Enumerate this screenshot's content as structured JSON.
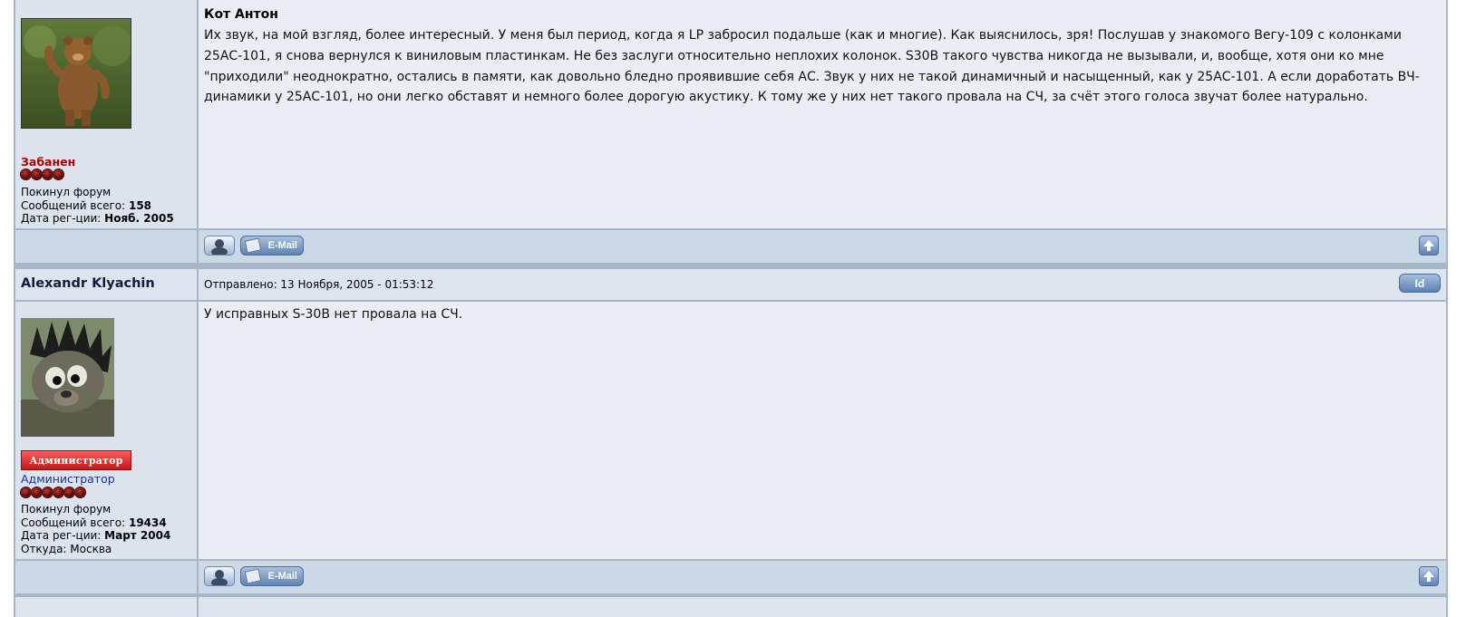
{
  "post1": {
    "quote_author": "Кот Антон",
    "body": "Их звук, на мой взгляд, более интересный. У меня был период, когда я LP забросил подальше (как и многие). Как выяснилось, зря! Послушав у знакомого Вегу-109 с колонками 25АС-101, я снова вернулся к виниловым пластинкам. Не без заслуги относительно неплохих колонок. S30B такого чувства никогда не вызывали, и, вообще, хотя они ко мне \"приходили\" неоднократно, остались в памяти, как довольно бледно проявившие себя АС. Звук у них не такой динамичный и насыщенный, как у 25АС-101. А если доработать ВЧ-динамики у 25АС-101, но они легко обставят и немного более дорогую акустику. К тому же у них нет такого провала на СЧ, за счёт этого голоса звучат более натурально.",
    "user": {
      "status": "Забанен",
      "status_color": "#b30000",
      "rank_stars": 4,
      "online": "Покинул форум",
      "posts_label": "Сообщений всего:",
      "posts_value": "158",
      "reg_label": "Дата рег-ции:",
      "reg_value": "Нояб. 2005",
      "avatar": "bear-avatar"
    }
  },
  "post2": {
    "author": "Alexandr Klyachin",
    "posted": "Отправлено: 13 Ноября, 2005 - 01:53:12",
    "id_label": "Id",
    "body": "У исправных S-30B нет провала на СЧ.",
    "user": {
      "badge": "Администратор",
      "role": "Администратор",
      "role_color": "#1a2fa0",
      "rank_stars": 6,
      "online": "Покинул форум",
      "posts_label": "Сообщений всего:",
      "posts_value": "19434",
      "reg_label": "Дата рег-ции:",
      "reg_value": "Март 2004",
      "from": "Откуда: Москва",
      "avatar": "hedgehog-avatar"
    }
  },
  "buttons": {
    "email_label": "E-Mail",
    "profile_icon": "profile-icon",
    "top_icon": "arrow-up-icon"
  }
}
